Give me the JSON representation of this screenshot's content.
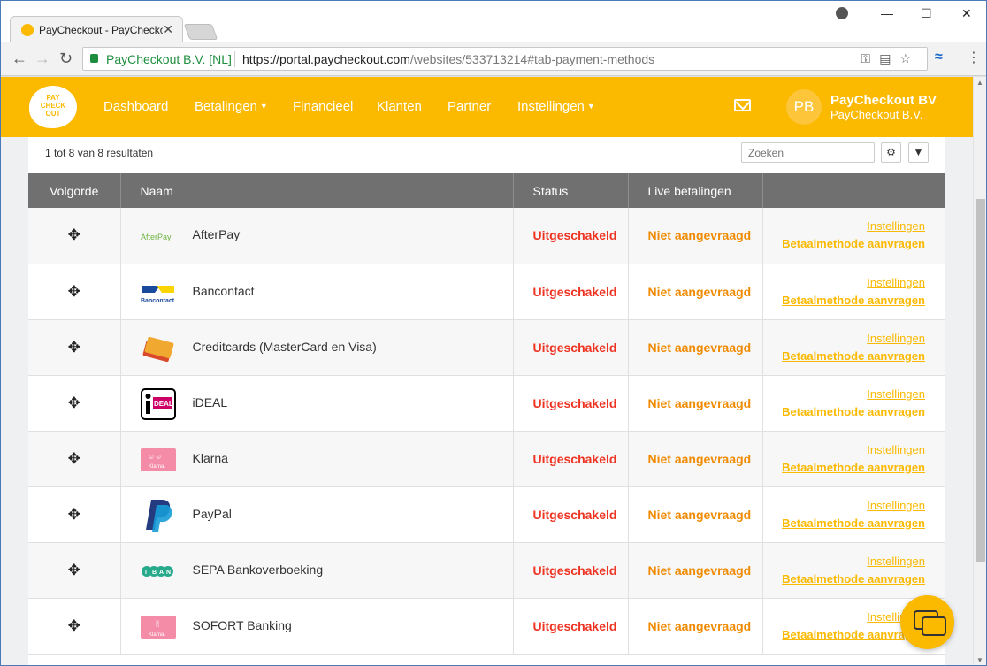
{
  "browser": {
    "tab_title": "PayCheckout - PayCheckout",
    "tab_close": "✕",
    "secure_label": "PayCheckout B.V. [NL]",
    "url_host": "https://portal.paycheckout.com",
    "url_path": "/websites/533713214#tab-payment-methods",
    "minimize": "—",
    "maximize": "☐",
    "close": "✕"
  },
  "nav": {
    "logo_text": "PAY CHECK OUT",
    "items": [
      "Dashboard",
      "Betalingen",
      "Financieel",
      "Klanten",
      "Partner",
      "Instellingen"
    ],
    "avatar_initials": "PB",
    "user_name": "PayCheckout BV",
    "user_org": "PayCheckout B.V."
  },
  "toolbar": {
    "results": "1 tot 8 van 8 resultaten",
    "search_placeholder": "Zoeken"
  },
  "table": {
    "headers": [
      "Volgorde",
      "Naam",
      "Status",
      "Live betalingen",
      ""
    ],
    "rows": [
      {
        "name": "AfterPay",
        "status": "Uitgeschakeld",
        "live": "Niet aangevraagd",
        "settings": "Instellingen",
        "request": "Betaalmethode aanvragen",
        "logo": "afterpay-logo"
      },
      {
        "name": "Bancontact",
        "status": "Uitgeschakeld",
        "live": "Niet aangevraagd",
        "settings": "Instellingen",
        "request": "Betaalmethode aanvragen",
        "logo": "bancontact-logo"
      },
      {
        "name": "Creditcards (MasterCard en Visa)",
        "status": "Uitgeschakeld",
        "live": "Niet aangevraagd",
        "settings": "Instellingen",
        "request": "Betaalmethode aanvragen",
        "logo": "creditcards-logo"
      },
      {
        "name": "iDEAL",
        "status": "Uitgeschakeld",
        "live": "Niet aangevraagd",
        "settings": "Instellingen",
        "request": "Betaalmethode aanvragen",
        "logo": "ideal-logo"
      },
      {
        "name": "Klarna",
        "status": "Uitgeschakeld",
        "live": "Niet aangevraagd",
        "settings": "Instellingen",
        "request": "Betaalmethode aanvragen",
        "logo": "klarna-logo"
      },
      {
        "name": "PayPal",
        "status": "Uitgeschakeld",
        "live": "Niet aangevraagd",
        "settings": "Instellingen",
        "request": "Betaalmethode aanvragen",
        "logo": "paypal-logo"
      },
      {
        "name": "SEPA Bankoverboeking",
        "status": "Uitgeschakeld",
        "live": "Niet aangevraagd",
        "settings": "Instellingen",
        "request": "Betaalmethode aanvragen",
        "logo": "sepa-iban-logo"
      },
      {
        "name": "SOFORT Banking",
        "status": "Uitgeschakeld",
        "live": "Niet aangevraagd",
        "settings": "Instellingen",
        "request": "Betaalmethode aanvragen",
        "logo": "sofort-klarna-logo"
      }
    ]
  },
  "colors": {
    "brand": "#fbb900",
    "status_disabled": "#ee3322",
    "live_pending": "#f08a00",
    "header_bg": "#707070"
  }
}
